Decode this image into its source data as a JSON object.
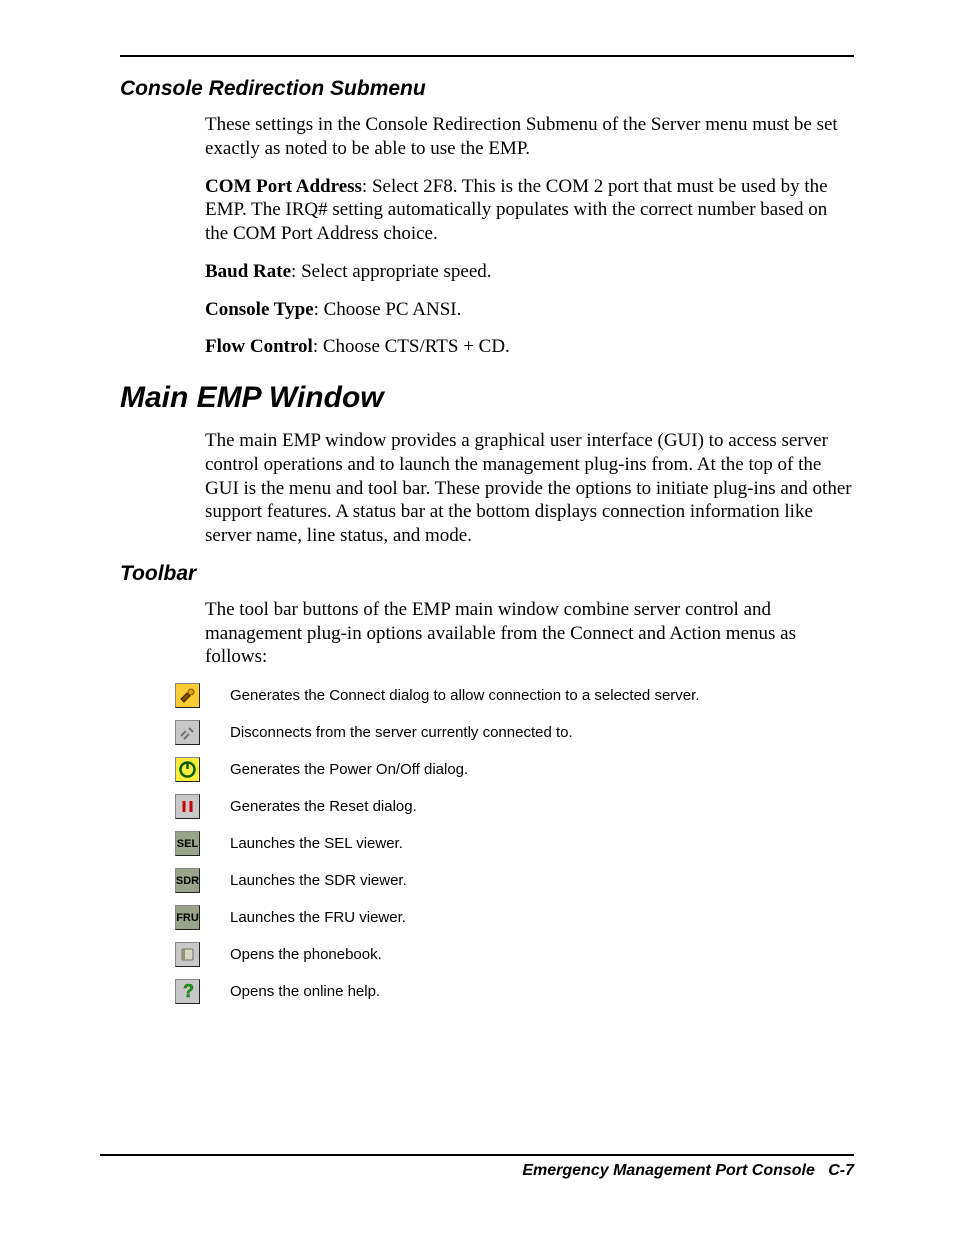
{
  "section1": {
    "heading": "Console Redirection Submenu",
    "p1": "These settings in the Console Redirection Submenu of the Server menu must be set exactly as noted to be able to use the EMP.",
    "p2_label": "COM Port Address",
    "p2_text": ": Select 2F8.  This is the COM 2 port that must be used by the EMP.  The IRQ# setting automatically populates with the correct number based on the COM Port Address choice.",
    "p3_label": "Baud Rate",
    "p3_text": ":  Select appropriate speed.",
    "p4_label": "Console Type",
    "p4_text": ":  Choose PC ANSI.",
    "p5_label": "Flow Control",
    "p5_text": ":  Choose CTS/RTS + CD."
  },
  "section2": {
    "heading": "Main EMP Window",
    "p1": "The main EMP window provides a graphical user interface (GUI) to access server control operations and to launch the management plug-ins from.  At the top of the GUI is the menu and tool bar.  These provide the options to initiate plug-ins and other support features.  A status bar at the bottom displays connection information like server name, line status, and mode."
  },
  "section3": {
    "heading": "Toolbar",
    "intro": "The tool bar buttons of the EMP main window combine server control and management plug-in options available from the Connect and Action menus as follows:"
  },
  "toolbar": [
    {
      "desc": "Generates the Connect dialog to allow connection to a selected server."
    },
    {
      "desc": "Disconnects from the server currently connected to."
    },
    {
      "desc": "Generates the Power On/Off dialog."
    },
    {
      "desc": "Generates the Reset dialog."
    },
    {
      "desc": "Launches the SEL viewer.",
      "label": "SEL"
    },
    {
      "desc": "Launches the SDR viewer.",
      "label": "SDR"
    },
    {
      "desc": "Launches the FRU viewer.",
      "label": "FRU"
    },
    {
      "desc": "Opens the phonebook."
    },
    {
      "desc": "Opens the online help."
    }
  ],
  "footer": {
    "title": "Emergency Management Port Console",
    "page": "C-7"
  }
}
